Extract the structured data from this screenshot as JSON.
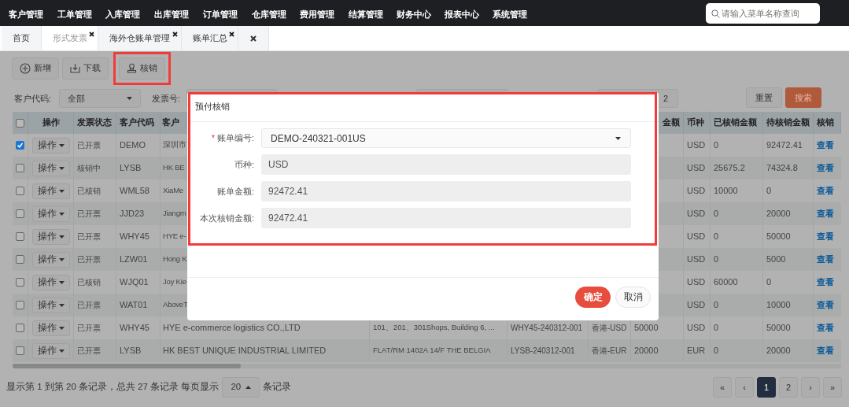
{
  "nav": {
    "items": [
      "客户管理",
      "工单管理",
      "入库管理",
      "出库管理",
      "订单管理",
      "仓库管理",
      "费用管理",
      "结算管理",
      "财务中心",
      "报表中心",
      "系统管理"
    ],
    "search": {
      "placeholder": "请输入菜单名称查询"
    }
  },
  "tabs": [
    {
      "label": "首页",
      "selected": false,
      "closable": false
    },
    {
      "label": "形式发票",
      "selected": true,
      "closable": true
    },
    {
      "label": "海外仓账单管理",
      "selected": false,
      "closable": true
    },
    {
      "label": "账单汇总",
      "selected": false,
      "closable": true
    }
  ],
  "toolbar": [
    {
      "label": "新增",
      "kind": "add",
      "highlighted": false
    },
    {
      "label": "下载",
      "kind": "download",
      "highlighted": false
    },
    {
      "label": "核销",
      "kind": "verify",
      "highlighted": true
    }
  ],
  "filters": {
    "customer_code": {
      "label": "客户代码:",
      "value": "全部"
    },
    "invoice_no": {
      "label": "发票号:"
    },
    "end_time": {
      "value": "2"
    }
  },
  "filter_buttons": [
    {
      "label": "重置",
      "kind": "default"
    },
    {
      "label": "搜索",
      "kind": "primary"
    }
  ],
  "table": {
    "header": {
      "checked": false,
      "operation": "操作",
      "status": "发票状态",
      "customer_code": "客户代码",
      "customer_name": "客户",
      "amount": "金额",
      "currency": "币种",
      "written_off": "已核销金额",
      "pending": "待核销金额",
      "detail": "核销"
    },
    "rows": [
      {
        "checked": true,
        "operation": "操作",
        "status": "已开票",
        "customer_code": "DEMO",
        "customer_name": "深圳市",
        "currency": "USD",
        "written_off": "0",
        "pending": "92472.41",
        "detail": "查看"
      },
      {
        "checked": false,
        "operation": "操作",
        "status": "核销中",
        "customer_code": "LYSB",
        "customer_name": "HK BE",
        "currency": "USD",
        "written_off": "25675.2",
        "pending": "74324.8",
        "detail": "查看"
      },
      {
        "checked": false,
        "operation": "操作",
        "status": "已核销",
        "customer_code": "WML58",
        "customer_name": "XiaMe",
        "currency": "USD",
        "written_off": "10000",
        "pending": "0",
        "detail": "查看"
      },
      {
        "checked": false,
        "operation": "操作",
        "status": "已开票",
        "customer_code": "JJD23",
        "customer_name": "Jiangm",
        "currency": "USD",
        "written_off": "0",
        "pending": "20000",
        "detail": "查看"
      },
      {
        "checked": false,
        "operation": "操作",
        "status": "已开票",
        "customer_code": "WHY45",
        "customer_name": "HYE e-",
        "currency": "USD",
        "written_off": "0",
        "pending": "50000",
        "detail": "查看"
      },
      {
        "checked": false,
        "operation": "操作",
        "status": "已开票",
        "customer_code": "LZW01",
        "customer_name": "Hong K",
        "currency": "USD",
        "written_off": "0",
        "pending": "5000",
        "detail": "查看"
      },
      {
        "checked": false,
        "operation": "操作",
        "status": "已核销",
        "customer_code": "WJQ01",
        "customer_name": "Joy Kie",
        "currency": "USD",
        "written_off": "60000",
        "pending": "0",
        "detail": "查看"
      },
      {
        "checked": false,
        "operation": "操作",
        "status": "已开票",
        "customer_code": "WAT01",
        "customer_name": "AboveT",
        "currency": "USD",
        "written_off": "0",
        "pending": "10000",
        "detail": "查看"
      },
      {
        "checked": false,
        "operation": "操作",
        "status": "已开票",
        "customer_code": "WHY45",
        "customer_name": "HYE e-commerce logistics CO.,LTD",
        "address": "101、201、301Shops, Building 6, ...",
        "bill_no": "WHY45-240312-001",
        "warehouse": "香港-USD",
        "amount": "50000",
        "currency": "USD",
        "written_off": "0",
        "pending": "50000",
        "detail": "查看"
      },
      {
        "checked": false,
        "operation": "操作",
        "status": "已开票",
        "customer_code": "LYSB",
        "customer_name": "HK BEST UNIQUE INDUSTRIAL LIMITED",
        "address": "FLAT/RM 1402A 14/F THE BELGIA",
        "bill_no": "LYSB-240312-001",
        "warehouse": "香港-EUR",
        "amount": "20000",
        "currency": "EUR",
        "written_off": "0",
        "pending": "20000",
        "detail": "查看"
      }
    ]
  },
  "footer": {
    "summary": "显示第 1 到第 20 条记录，总共 27 条记录 每页显示",
    "page_size": "20",
    "suffix": "条记录",
    "pages": [
      {
        "label": "«",
        "selected": false
      },
      {
        "label": "‹",
        "selected": false
      },
      {
        "label": "1",
        "selected": true
      },
      {
        "label": "2",
        "selected": false
      },
      {
        "label": "›",
        "selected": false
      },
      {
        "label": "»",
        "selected": false
      }
    ]
  },
  "modal": {
    "title": "预付核销",
    "highlighted": true,
    "fields": [
      {
        "label": "账单编号:",
        "required_mark": "*",
        "kind": "select",
        "value": "DEMO-240321-001US"
      },
      {
        "label": "币种:",
        "kind": "readonly",
        "value": "USD"
      },
      {
        "label": "账单金额:",
        "kind": "readonly",
        "value": "92472.41"
      },
      {
        "label": "本次核销金额:",
        "kind": "readonly",
        "value": "92472.41"
      }
    ],
    "buttons": [
      {
        "label": "确定",
        "kind": "primary"
      },
      {
        "label": "取消",
        "kind": "default"
      }
    ]
  }
}
